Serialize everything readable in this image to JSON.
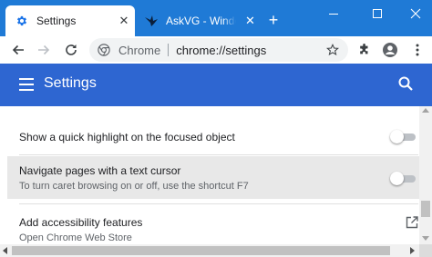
{
  "browser": {
    "colors": {
      "tabstrip": "#1f7ad6",
      "active_tab": "#ffffff",
      "toolbar": "#ffffff"
    },
    "tabs": [
      {
        "title": "Settings",
        "favicon": "gear-icon",
        "active": true,
        "close_glyph": "✕"
      },
      {
        "title": "AskVG - Windows T",
        "favicon": "askvg-bird-icon",
        "active": false,
        "close_glyph": "✕"
      }
    ],
    "new_tab_glyph": "+",
    "window_controls": [
      "minimize-icon",
      "maximize-icon",
      "close-icon"
    ],
    "toolbar": {
      "back_icon": "arrow-left-icon",
      "forward_icon": "arrow-right-icon",
      "reload_icon": "reload-icon",
      "omnibox": {
        "site_icon": "chrome-logo-icon",
        "chip_label": "Chrome",
        "url": "chrome://settings",
        "bookmark_icon": "star-icon"
      },
      "extensions_icon": "puzzle-icon",
      "profile_icon": "account-circle-icon",
      "menu_icon": "kebab-menu-icon"
    }
  },
  "settings": {
    "header": {
      "title": "Settings",
      "menu_icon": "hamburger-icon",
      "search_icon": "search-icon",
      "color": "#2e66d1"
    },
    "rows": [
      {
        "primary": "Show a quick highlight on the focused object",
        "control": "toggle",
        "enabled": false
      },
      {
        "primary": "Navigate pages with a text cursor",
        "secondary": "To turn caret browsing on or off, use the shortcut F7",
        "control": "toggle",
        "enabled": false,
        "hovered": true
      },
      {
        "primary": "Add accessibility features",
        "secondary": "Open Chrome Web Store",
        "control": "launch-icon"
      }
    ]
  }
}
